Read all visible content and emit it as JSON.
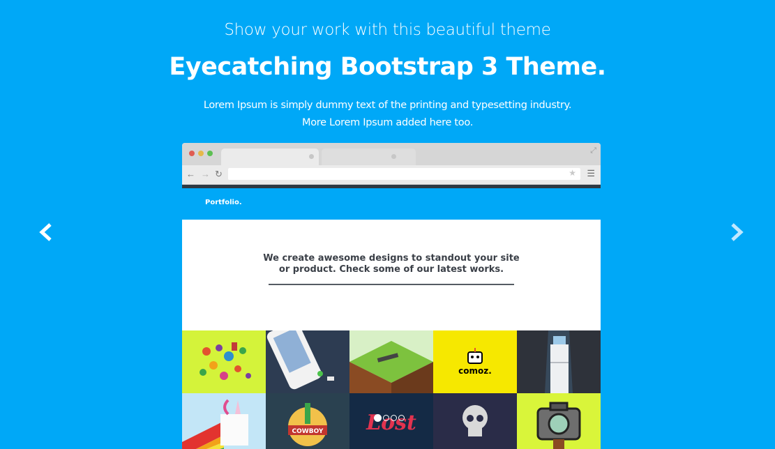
{
  "header": {
    "subtitle": "Show your work with this beautiful theme",
    "title": "Eyecatching Bootstrap 3 Theme.",
    "description_line1": "Lorem Ipsum is simply dummy text of the printing and typesetting industry.",
    "description_line2": "More Lorem Ipsum added here too."
  },
  "carousel": {
    "prev_icon": "chevron-left-icon",
    "next_icon": "chevron-right-icon",
    "slide_count": 4,
    "active_index": 0
  },
  "mockup": {
    "brand": "Portfolio.",
    "hero_line1": "We create awesome designs to standout your site",
    "hero_line2": "or product. Check some of our latest works.",
    "tiles": [
      {
        "name": "candy-illustration",
        "bg": "#d4f33a"
      },
      {
        "name": "phone-illustration",
        "bg": "#2d3c52"
      },
      {
        "name": "lost-person-illustration",
        "bg": "#d8f0c6"
      },
      {
        "name": "comoz-logo",
        "bg": "#f6e800",
        "label": "comoz."
      },
      {
        "name": "fridge-illustration",
        "bg": "#2e323a"
      },
      {
        "name": "unicorn-illustration",
        "bg": "#c3e6f7"
      },
      {
        "name": "cowboy-badge",
        "bg": "#2a4150",
        "label": "COWBOY"
      },
      {
        "name": "lost-lettering",
        "bg": "#142a45",
        "label": "Lost"
      },
      {
        "name": "skull-illustration",
        "bg": "#2a2c48"
      },
      {
        "name": "camera-illustration",
        "bg": "#d9f53a"
      }
    ]
  },
  "colors": {
    "page_bg": "#00a8f7",
    "text": "#ffffff",
    "mockup_nav": "#00a8f7"
  }
}
